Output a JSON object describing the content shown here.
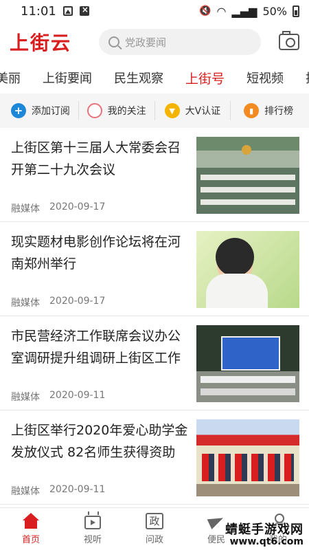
{
  "status_bar": {
    "time": "11:01",
    "battery": "50%"
  },
  "header": {
    "logo": "上街云",
    "search_placeholder": "党政要闻"
  },
  "tabs": [
    "美丽",
    "上街要闻",
    "民生观察",
    "上街号",
    "短视频",
    "投"
  ],
  "active_tab": "上街号",
  "quick_actions": [
    {
      "label": "添加订阅",
      "icon": "plus-circle-icon"
    },
    {
      "label": "我的关注",
      "icon": "ring-icon"
    },
    {
      "label": "大V认证",
      "icon": "v-badge-icon"
    },
    {
      "label": "排行榜",
      "icon": "ranking-icon"
    }
  ],
  "news": [
    {
      "title": "上街区第十三届人大常委会召开第二十九次会议",
      "source": "融媒体",
      "date": "2020-09-17"
    },
    {
      "title": "现实题材电影创作论坛将在河南郑州举行",
      "source": "融媒体",
      "date": "2020-09-17"
    },
    {
      "title": "市民营经济工作联席会议办公室调研提升组调研上街区工作",
      "source": "融媒体",
      "date": "2020-09-11"
    },
    {
      "title": "上街区举行2020年爱心助学金发放仪式 82名师生获得资助",
      "source": "融媒体",
      "date": "2020-09-11"
    }
  ],
  "bottom_nav": [
    {
      "label": "首页",
      "icon": "home-icon"
    },
    {
      "label": "视听",
      "icon": "tv-icon"
    },
    {
      "label": "问政",
      "icon": "zheng-icon"
    },
    {
      "label": "便民",
      "icon": "send-icon"
    },
    {
      "label": "我的",
      "icon": "user-icon"
    }
  ],
  "watermark": {
    "line1": "蜻蜓手游戏网",
    "line2": "www.qt6.com"
  },
  "colors": {
    "brand": "#d81e1e",
    "quick_bar_bg": "#f5f5f5"
  }
}
